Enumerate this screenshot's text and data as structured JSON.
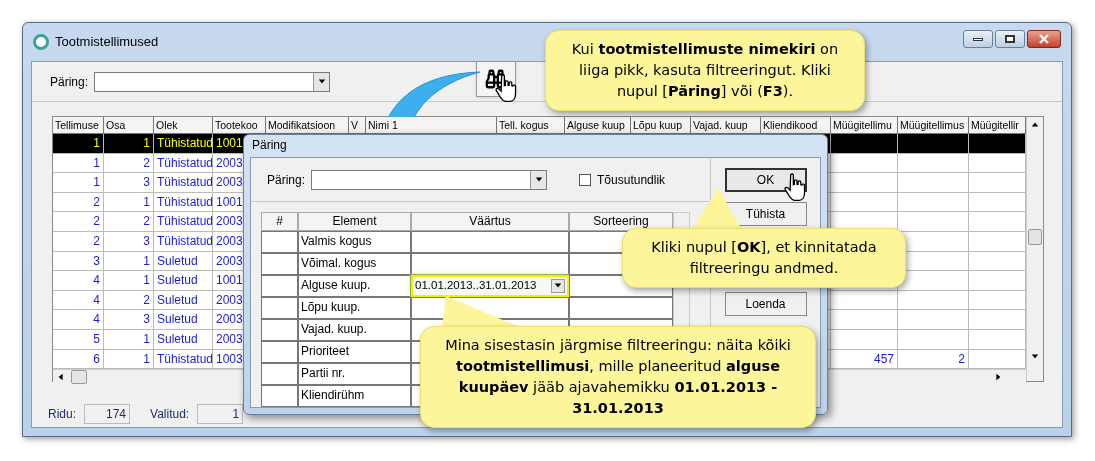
{
  "window": {
    "title": "Tootmistellimused",
    "query_label": "Päring:"
  },
  "table": {
    "columns": [
      "Tellimuse",
      "Osa",
      "Olek",
      "Tootekoo",
      "Modifikatsioon",
      "V",
      "Nimi 1",
      "Tell. kogus",
      "Alguse kuup",
      "Lõpu kuup",
      "Vajad. kuup",
      "Kliendikood",
      "Müügitellimu",
      "Müügitellimus",
      "Müügitellir"
    ],
    "rows": [
      {
        "selected": true,
        "cells": [
          "1",
          "1",
          "Tühistatud",
          "1001"
        ]
      },
      {
        "selected": false,
        "cells": [
          "1",
          "2",
          "Tühistatud",
          "2003"
        ]
      },
      {
        "selected": false,
        "cells": [
          "1",
          "3",
          "Tühistatud",
          "2003"
        ]
      },
      {
        "selected": false,
        "cells": [
          "2",
          "1",
          "Tühistatud",
          "1001"
        ]
      },
      {
        "selected": false,
        "cells": [
          "2",
          "2",
          "Tühistatud",
          "2003"
        ]
      },
      {
        "selected": false,
        "cells": [
          "2",
          "3",
          "Tühistatud",
          "2003"
        ]
      },
      {
        "selected": false,
        "cells": [
          "3",
          "1",
          "Suletud",
          "2003"
        ]
      },
      {
        "selected": false,
        "cells": [
          "4",
          "1",
          "Suletud",
          "1001"
        ]
      },
      {
        "selected": false,
        "cells": [
          "4",
          "2",
          "Suletud",
          "2003"
        ]
      },
      {
        "selected": false,
        "cells": [
          "4",
          "3",
          "Suletud",
          "2003"
        ]
      },
      {
        "selected": false,
        "cells": [
          "5",
          "1",
          "Suletud",
          "2003"
        ]
      },
      {
        "selected": false,
        "cells": [
          "6",
          "1",
          "Tühistatud",
          "1003"
        ],
        "extra_cells": [
          "457",
          "2"
        ]
      }
    ]
  },
  "status_bar": {
    "rows_label": "Ridu:",
    "rows_value": "174",
    "selected_label": "Valitud:",
    "selected_value": "1"
  },
  "dialog": {
    "title": "Päring",
    "query_label": "Päring:",
    "case_sensitive": {
      "label": "Tõusutundlik",
      "checked": false
    },
    "columns": [
      "#",
      "Element",
      "Väärtus",
      "Sorteering"
    ],
    "rows": [
      {
        "element": "Valmis kogus",
        "highlighted": false
      },
      {
        "element": "Võimal. kogus",
        "highlighted": false
      },
      {
        "element": "Alguse kuup.",
        "value": "01.01.2013..31.01.2013",
        "highlighted": true
      },
      {
        "element": "Lõpu kuup.",
        "highlighted": false
      },
      {
        "element": "Vajad. kuup.",
        "highlighted": false
      },
      {
        "element": "Prioriteet",
        "highlighted": false
      },
      {
        "element": "Partii nr.",
        "highlighted": false
      },
      {
        "element": "Kliendirühm",
        "highlighted": false
      }
    ],
    "buttons": [
      {
        "label": "OK",
        "focused": true
      },
      {
        "label": "Tühista",
        "focused": false
      },
      {
        "label": "Loenda",
        "focused": false
      }
    ]
  },
  "callouts": [
    {
      "text": "Kui **tootmistellimuste nimekiri** on liiga pikk, kasuta filtreeringut. Kliki nupul [**Päring**] või (**F3**)."
    },
    {
      "text": "Kliki nupul [**OK**], et kinnitatada filtreeringu andmed."
    },
    {
      "text": "Mina sisestasin järgmise filtreeringu: näita kõiki **tootmistellimusi**, mille planeeritud **alguse kuupäev** jääb ajavahemikku **01.01.2013 - 31.01.2013**"
    }
  ]
}
